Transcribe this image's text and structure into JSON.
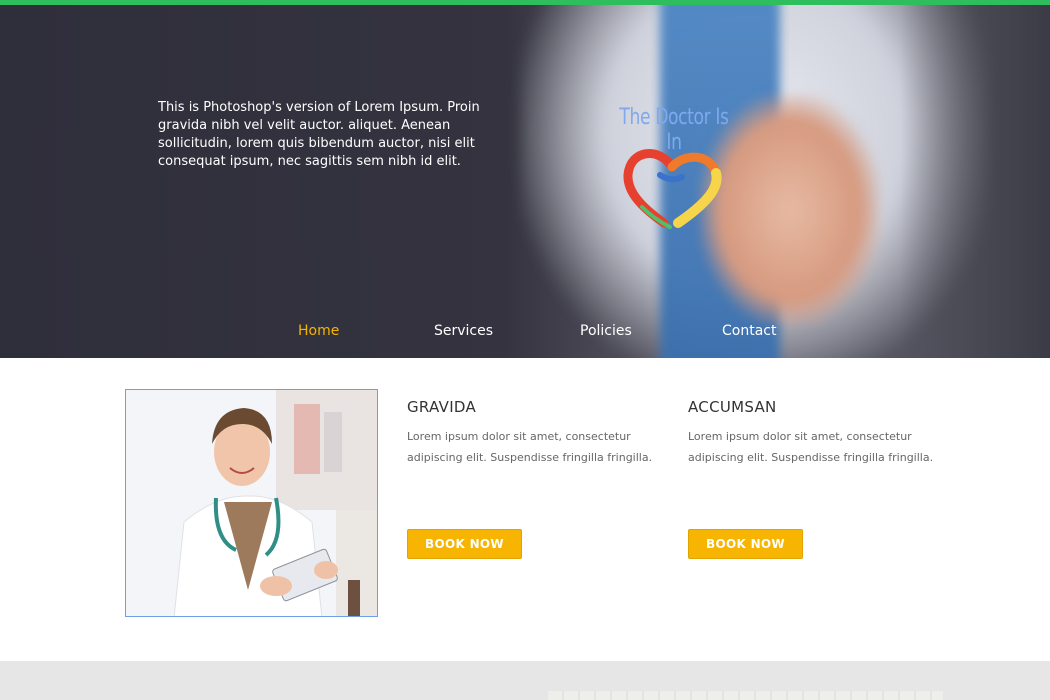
{
  "hero": {
    "intro_text": "This is Photoshop's version of Lorem Ipsum. Proin gravida nibh vel velit auctor. aliquet. Aenean sollicitudin, lorem quis bibendum auctor, nisi elit consequat ipsum, nec sagittis sem nibh id elit.",
    "brand_name": "The Doctor Is In"
  },
  "nav": {
    "items": [
      {
        "label": "Home",
        "active": true
      },
      {
        "label": "Services",
        "active": false
      },
      {
        "label": "Policies",
        "active": false
      },
      {
        "label": "Contact",
        "active": false
      }
    ]
  },
  "cards": [
    {
      "title": "GRAVIDA",
      "text": "Lorem ipsum dolor sit amet, consectetur adipiscing elit. Suspendisse fringilla fringilla.",
      "button_label": "BOOK NOW"
    },
    {
      "title": "ACCUMSAN",
      "text": "Lorem ipsum dolor sit amet, consectetur adipiscing elit. Suspendisse fringilla fringilla.",
      "button_label": "BOOK NOW"
    }
  ],
  "colors": {
    "accent_green": "#2fbe5e",
    "nav_active": "#f5b400",
    "button": "#f7b400",
    "brand_text": "#7ea9ec",
    "hero_bg": "#34333f"
  },
  "icons": {
    "logo": "heart-ribbon-logo-icon"
  }
}
